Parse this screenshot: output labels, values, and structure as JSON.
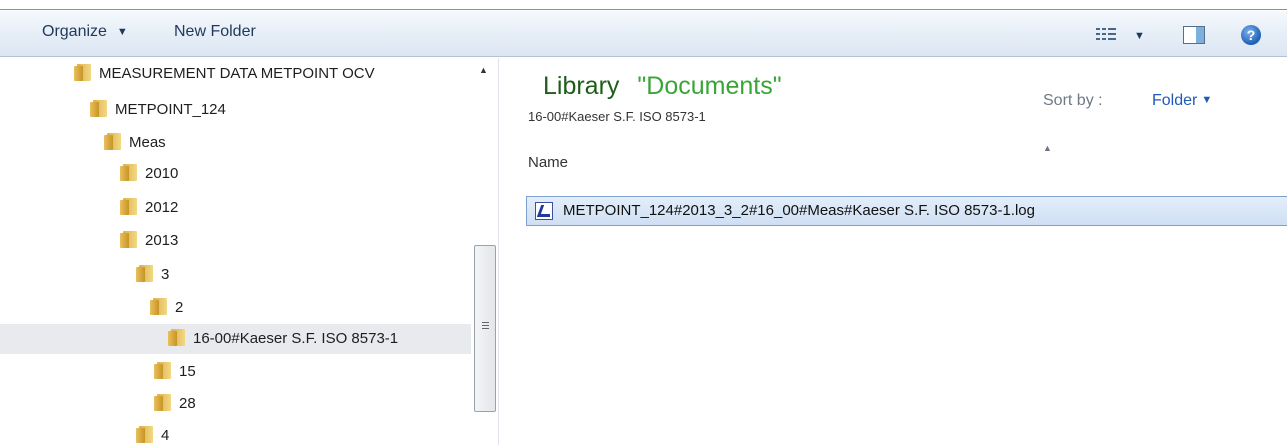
{
  "toolbar": {
    "organize_label": "Organize",
    "new_folder_label": "New Folder"
  },
  "nav_tree": {
    "items": [
      {
        "label": "MEASUREMENT DATA METPOINT OCV"
      },
      {
        "label": "METPOINT_124"
      },
      {
        "label": "Meas"
      },
      {
        "label": "2010"
      },
      {
        "label": "2012"
      },
      {
        "label": "2013"
      },
      {
        "label": "3"
      },
      {
        "label": "2"
      },
      {
        "label": "16-00#Kaeser S.F. ISO 8573-1",
        "selected": true
      },
      {
        "label": "15"
      },
      {
        "label": "28"
      },
      {
        "label": "4"
      }
    ]
  },
  "library": {
    "title": "Library",
    "name": "\"Documents\"",
    "subtitle": "16-00#Kaeser S.F. ISO 8573-1",
    "sort_label": "Sort by :",
    "sort_value": "Folder"
  },
  "file_list": {
    "column_name": "Name",
    "files": [
      {
        "name": "METPOINT_124#2013_3_2#16_00#Meas#Kaeser S.F. ISO 8573-1.log"
      }
    ]
  },
  "icons": {
    "folder": "folder-icon",
    "log_file": "log-file-icon",
    "help": "help-icon",
    "preview_pane": "preview-pane-icon",
    "view": "view-options-icon"
  },
  "colors": {
    "library_title": "#1e5e1a",
    "library_name": "#3aa537",
    "sort_value": "#1d5bb6",
    "selection": "#cfdff3"
  }
}
